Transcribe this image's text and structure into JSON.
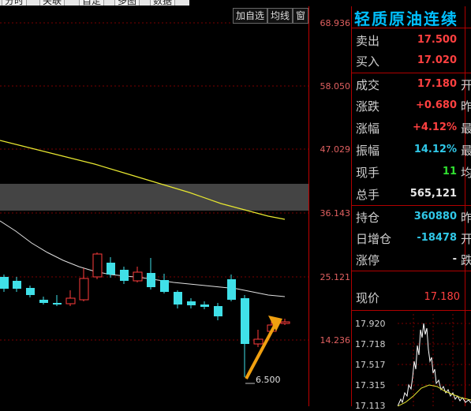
{
  "toolbar": {
    "tabs": [
      "分时",
      "关联",
      "自定",
      "多图",
      "数据"
    ]
  },
  "chart_buttons": {
    "add_watch": "加自选",
    "ma": "均线",
    "window": "窗"
  },
  "y_axis": {
    "labels": [
      "68.936",
      "58.050",
      "47.029",
      "36.143",
      "25.121",
      "14.236"
    ]
  },
  "low_annotation": "6.500",
  "colors": {
    "up": "#ff3c3c",
    "down": "#40e0e8",
    "ma_long": "#e8e830",
    "ma_short": "#e0e0e0",
    "arrow": "#f0a010"
  },
  "panel": {
    "title": "轻质原油连续",
    "rows": [
      {
        "label": "卖出",
        "value": "17.500",
        "color": "#ff4040",
        "cut": ""
      },
      {
        "label": "买入",
        "value": "17.020",
        "color": "#ff4040",
        "cut": ""
      },
      {
        "label": "成交",
        "value": "17.180",
        "color": "#ff4040",
        "cut": "开"
      },
      {
        "label": "涨跌",
        "value": "+0.680",
        "color": "#ff4040",
        "cut": "昨"
      },
      {
        "label": "涨幅",
        "value": "+4.12%",
        "color": "#ff4040",
        "cut": "最"
      },
      {
        "label": "振幅",
        "value": "14.12%",
        "color": "#30c8e8",
        "cut": "最"
      },
      {
        "label": "现手",
        "value": "11",
        "color": "#30e030",
        "cut": "均"
      },
      {
        "label": "总手",
        "value": "565,121",
        "color": "#e8e8e8",
        "cut": ""
      },
      {
        "label": "持仓",
        "value": "360880",
        "color": "#30c8e8",
        "cut": "昨"
      },
      {
        "label": "日增仓",
        "value": "-18478",
        "color": "#30c8e8",
        "cut": "开"
      },
      {
        "label": "涨停",
        "value": "-",
        "color": "#e8e8e8",
        "cut": "跌"
      }
    ],
    "current_price_label": "现价",
    "current_price": "17.180",
    "mini_chart_labels": [
      "17.920",
      "17.718",
      "17.517",
      "17.315",
      "17.113"
    ]
  }
}
